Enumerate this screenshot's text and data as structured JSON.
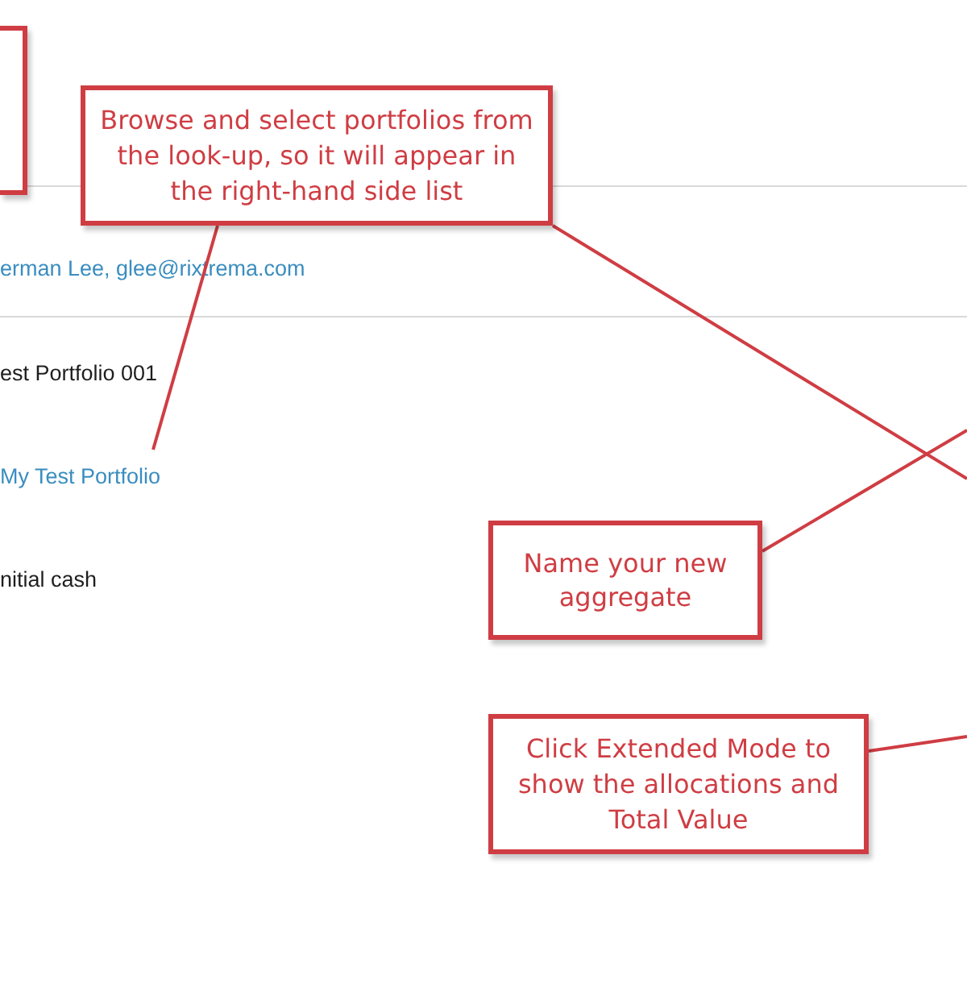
{
  "form": {
    "owner": "erman Lee, glee@rixtrema.com",
    "fields": [
      {
        "kind": "text",
        "value": "est Portfolio 001"
      },
      {
        "kind": "link",
        "value": "My Test Portfolio"
      },
      {
        "kind": "text",
        "value": "nitial cash"
      }
    ]
  },
  "callouts": [
    {
      "kind": "cropped"
    },
    {
      "kind": "note",
      "text": "Browse and select portfolios from the look-up, so it will appear in the right-hand side list"
    },
    {
      "kind": "note",
      "text": "Name your new aggregate"
    },
    {
      "kind": "note",
      "text": "Click Extended Mode to show the allocations and Total Value"
    }
  ]
}
